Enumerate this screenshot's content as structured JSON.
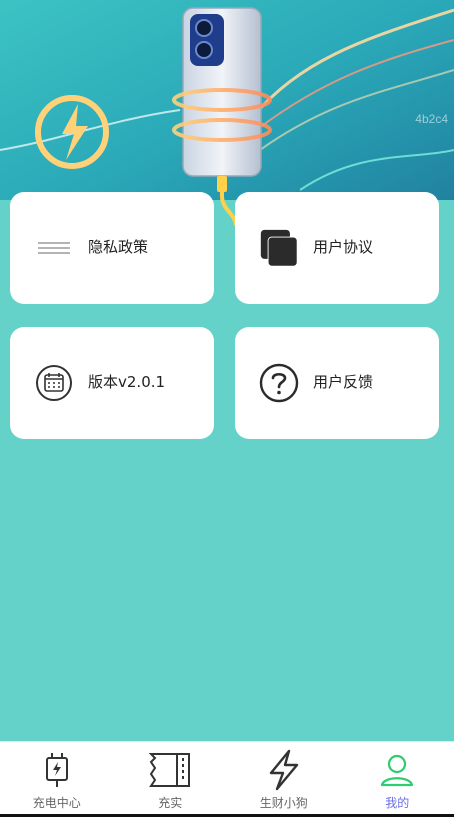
{
  "banner": {
    "watermark": "4b2c4"
  },
  "menu": [
    {
      "id": "privacy",
      "label": "隐私政策",
      "icon": "menu-lines-icon"
    },
    {
      "id": "agreement",
      "label": "用户协议",
      "icon": "overlapping-squares-icon"
    },
    {
      "id": "version",
      "label": "版本v2.0.1",
      "icon": "calendar-icon"
    },
    {
      "id": "feedback",
      "label": "用户反馈",
      "icon": "question-circle-icon"
    }
  ],
  "tabbar": {
    "items": [
      {
        "label": "充电中心",
        "icon": "charger-plug-icon",
        "active": false
      },
      {
        "label": "充实",
        "icon": "ticket-icon",
        "active": false
      },
      {
        "label": "生财小狗",
        "icon": "lightning-icon",
        "active": false
      },
      {
        "label": "我的",
        "icon": "user-icon",
        "active": true
      }
    ],
    "active_color": "#6a6ee8",
    "active_icon_color": "#2ecc71"
  },
  "colors": {
    "background": "#65d2c9",
    "card": "#ffffff"
  }
}
